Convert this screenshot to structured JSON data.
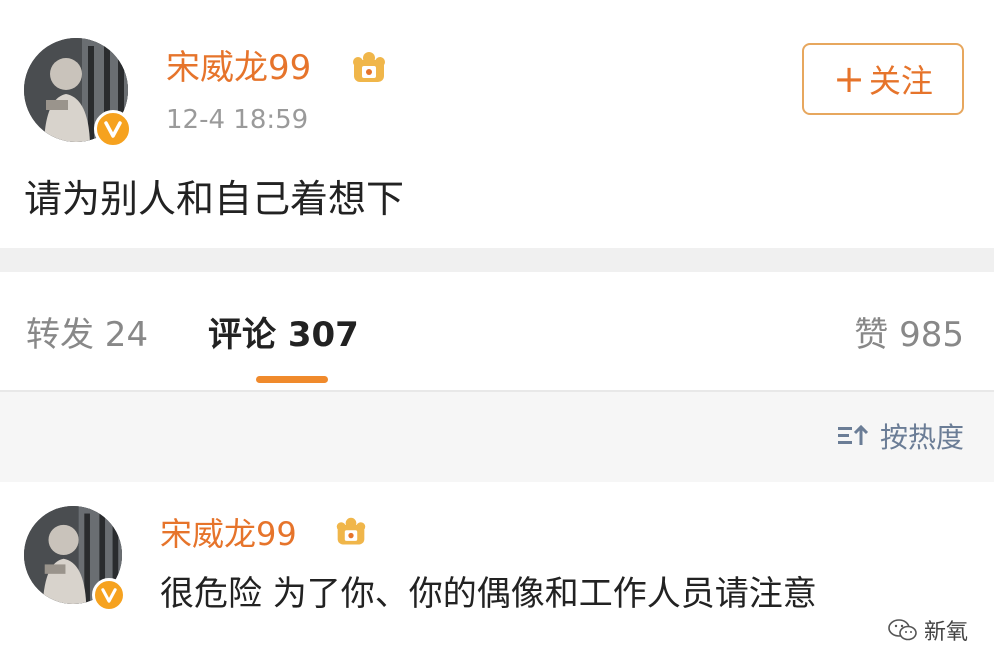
{
  "post": {
    "username": "宋威龙99",
    "timestamp": "12-4 18:59",
    "follow_label": "关注",
    "text": "请为别人和自己着想下"
  },
  "tabs": {
    "repost": "转发 24",
    "comment": "评论 307",
    "like": "赞 985"
  },
  "sort": {
    "label": "按热度"
  },
  "comment": {
    "username": "宋威龙99",
    "text": "很危险 为了你、你的偶像和工作人员请注意"
  },
  "watermark": {
    "text": "新氧"
  },
  "icons": {
    "verified": "verified-v-icon",
    "crown": "crown-vip-icon",
    "sort": "sort-icon",
    "watermark": "wechat-icon"
  },
  "colors": {
    "username": "#e6742b",
    "accent": "#f08a2c",
    "badge": "#f6a21f",
    "sort": "#6b7d96"
  }
}
